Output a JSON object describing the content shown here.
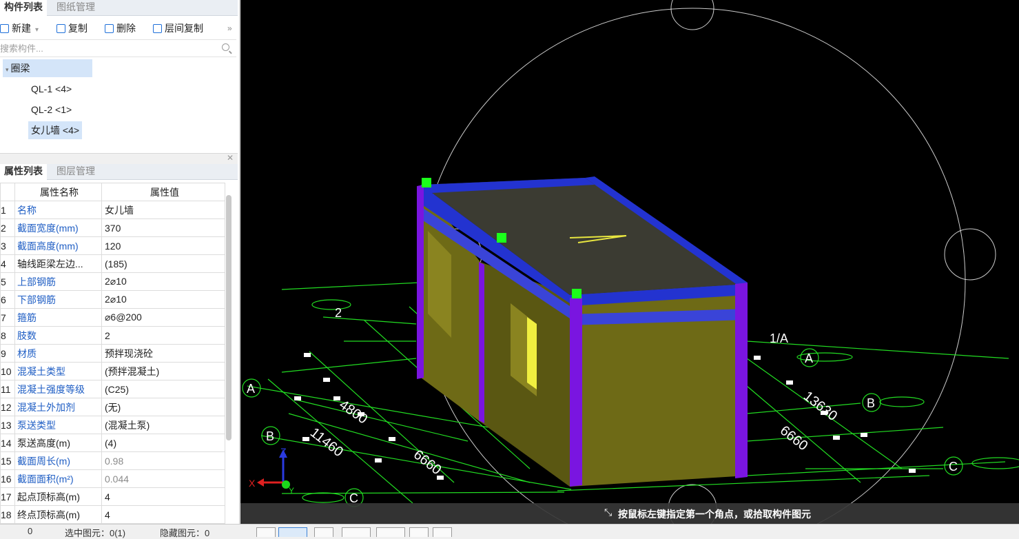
{
  "component_panel": {
    "tabs": [
      "构件列表",
      "图纸管理"
    ],
    "toolbar": {
      "new": "新建",
      "copy": "复制",
      "delete": "删除",
      "floor_copy": "层间复制",
      "more": "»"
    },
    "search_placeholder": "搜索构件...",
    "tree": {
      "category": "圈梁",
      "items": [
        {
          "label": "QL-1 <4>"
        },
        {
          "label": "QL-2 <1>"
        },
        {
          "label": "女儿墙 <4>"
        }
      ]
    }
  },
  "property_panel": {
    "tabs": [
      "属性列表",
      "图层管理"
    ],
    "col_name": "属性名称",
    "col_value": "属性值",
    "rows": [
      {
        "no": "1",
        "name": "名称",
        "value": "女儿墙"
      },
      {
        "no": "2",
        "name": "截面宽度(mm)",
        "value": "370"
      },
      {
        "no": "3",
        "name": "截面高度(mm)",
        "value": "120"
      },
      {
        "no": "4",
        "name": "轴线距梁左边...",
        "value": "(185)"
      },
      {
        "no": "5",
        "name": "上部钢筋",
        "value": "2⌀10"
      },
      {
        "no": "6",
        "name": "下部钢筋",
        "value": "2⌀10"
      },
      {
        "no": "7",
        "name": "箍筋",
        "value": "⌀6@200"
      },
      {
        "no": "8",
        "name": "肢数",
        "value": "2"
      },
      {
        "no": "9",
        "name": "材质",
        "value": "预拌现浇砼"
      },
      {
        "no": "10",
        "name": "混凝土类型",
        "value": "(预拌混凝土)"
      },
      {
        "no": "11",
        "name": "混凝土强度等级",
        "value": "(C25)"
      },
      {
        "no": "12",
        "name": "混凝土外加剂",
        "value": "(无)"
      },
      {
        "no": "13",
        "name": "泵送类型",
        "value": "(混凝土泵)"
      },
      {
        "no": "14",
        "name": "泵送高度(m)",
        "value": "(4)"
      },
      {
        "no": "15",
        "name": "截面周长(m)",
        "value": "0.98"
      },
      {
        "no": "16",
        "name": "截面面积(m²)",
        "value": "0.044"
      },
      {
        "no": "17",
        "name": "起点顶标高(m)",
        "value": "4"
      },
      {
        "no": "18",
        "name": "终点顶标高(m)",
        "value": "4"
      }
    ]
  },
  "viewport": {
    "axis_labels": {
      "A_left": "A",
      "B_left": "B",
      "C_left": "C",
      "A_right": "A",
      "B_right": "B",
      "C_right": "C",
      "one_a": "1/A",
      "two": "2"
    },
    "dimensions": {
      "d4800": "4800",
      "d11460": "11460",
      "d6660_left": "6660",
      "d13630": "13630",
      "d6660_right": "6660"
    },
    "axis_gizmo": {
      "x": "X",
      "y": "Y",
      "z": "Z"
    },
    "colors": {
      "wall": "#6e6a16",
      "beam": "#2333d0",
      "column": "#7a15e0",
      "grid": "#22dd22",
      "handle": "#1bff1b"
    }
  },
  "status": {
    "message": "按鼠标左键指定第一个角点，或拾取构件图元"
  },
  "bottom_bar": {
    "text1": "0 ",
    "text2": "选中图元：0(1)",
    "text3": "隐藏图元：0"
  }
}
